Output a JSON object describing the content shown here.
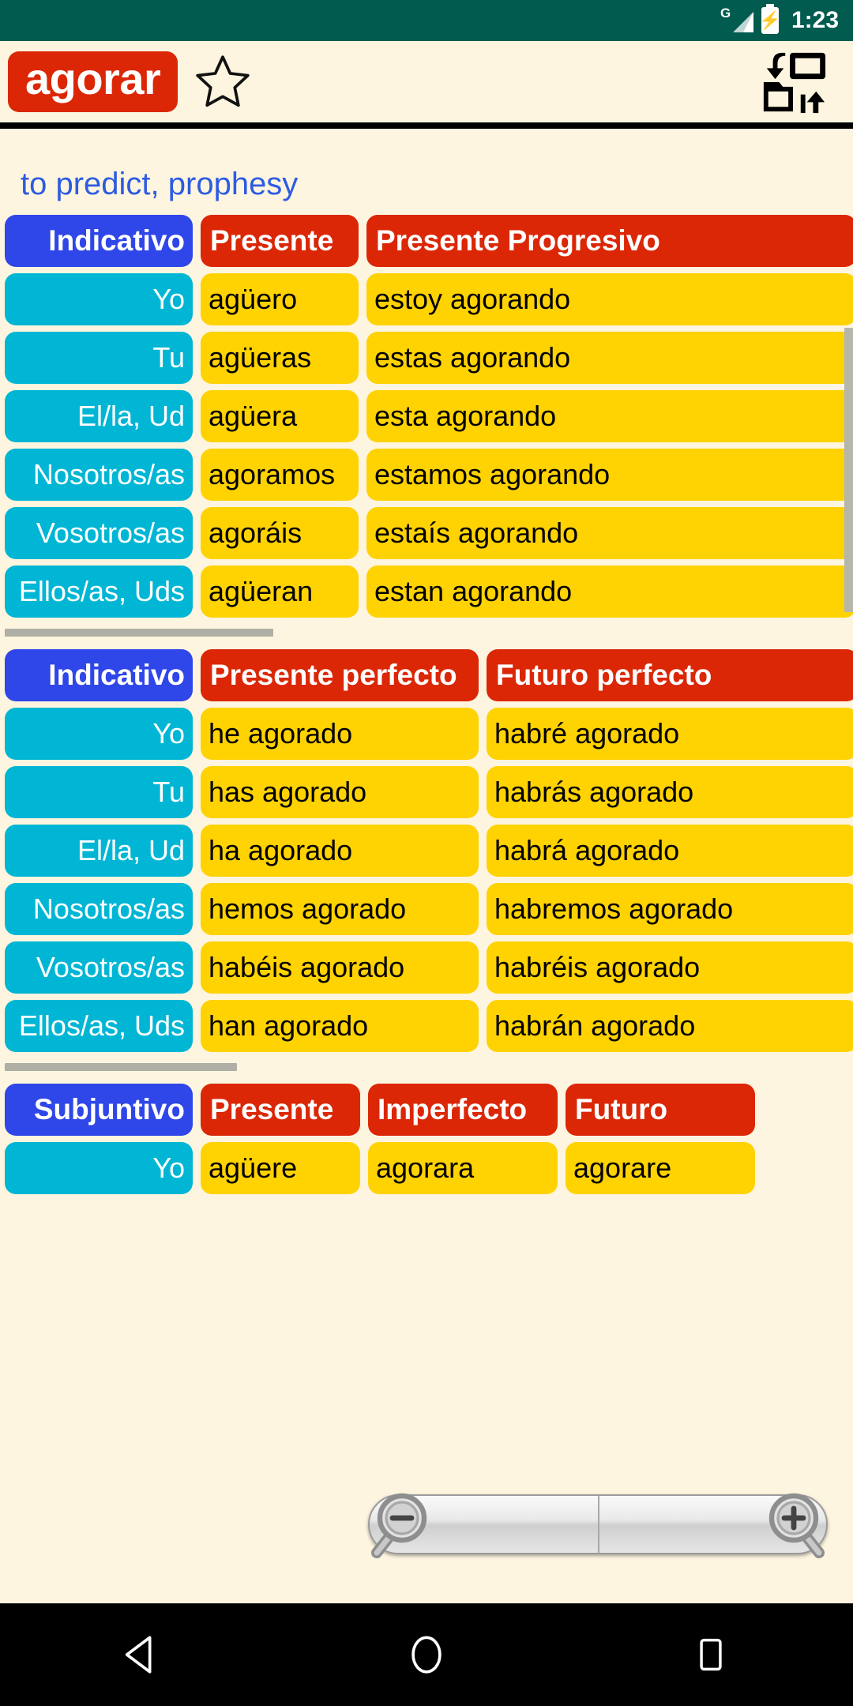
{
  "status_bar": {
    "network_label": "G",
    "signal_icon": "signal-bars-icon",
    "battery_icon": "battery-charging-icon",
    "time": "1:23"
  },
  "app_bar": {
    "verb": "agorar",
    "favorite_icon": "star-outline-icon",
    "swap_icon": "swap-screens-icon"
  },
  "content": {
    "translation": "to predict, prophesy",
    "tables": [
      {
        "mood": "Indicativo",
        "tenses": [
          "Presente",
          "Presente Progresivo"
        ],
        "pronouns": [
          "Yo",
          "Tu",
          "El/la, Ud",
          "Nosotros/as",
          "Vosotros/as",
          "Ellos/as, Uds"
        ],
        "rows": [
          [
            "agüero",
            "estoy agorando"
          ],
          [
            "agüeras",
            "estas agorando"
          ],
          [
            "agüera",
            "esta agorando"
          ],
          [
            "agoramos",
            "estamos agorando"
          ],
          [
            "agoráis",
            "estaís agorando"
          ],
          [
            "agüeran",
            "estan agorando"
          ]
        ]
      },
      {
        "mood": "Indicativo",
        "tenses": [
          "Presente perfecto",
          "Futuro perfecto"
        ],
        "pronouns": [
          "Yo",
          "Tu",
          "El/la, Ud",
          "Nosotros/as",
          "Vosotros/as",
          "Ellos/as, Uds"
        ],
        "rows": [
          [
            "he agorado",
            "habré agorado"
          ],
          [
            "has agorado",
            "habrás agorado"
          ],
          [
            "ha agorado",
            "habrá agorado"
          ],
          [
            "hemos agorado",
            "habremos agorado"
          ],
          [
            "habéis agorado",
            "habréis agorado"
          ],
          [
            "han agorado",
            "habrán agorado"
          ]
        ]
      },
      {
        "mood": "Subjuntivo",
        "tenses": [
          "Presente",
          "Imperfecto",
          "Futuro"
        ],
        "pronouns": [
          "Yo"
        ],
        "rows": [
          [
            "agüere",
            "agorara",
            "agorare"
          ]
        ]
      }
    ]
  },
  "zoom_control": {
    "zoom_out_icon": "magnifier-minus-icon",
    "zoom_in_icon": "magnifier-plus-icon"
  },
  "nav_bar": {
    "back_icon": "back-triangle-icon",
    "home_icon": "home-circle-icon",
    "recents_icon": "recents-square-icon"
  },
  "colors": {
    "status_bar": "#015B4F",
    "page_background": "#FDF5DF",
    "verb_chip": "#DB2706",
    "mood_header": "#2F46E8",
    "tense_header": "#DB2706",
    "pronoun_cell": "#00B6D4",
    "conjugation_cell": "#FFD202",
    "translation_text": "#2D5BE3"
  }
}
